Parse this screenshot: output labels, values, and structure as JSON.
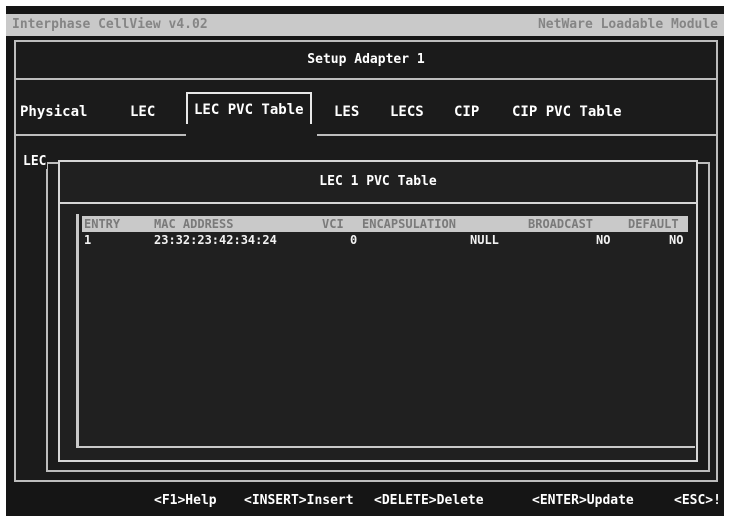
{
  "titlebar": {
    "app": "Interphase CellView  v4.02",
    "module": "NetWare Loadable Module"
  },
  "window": {
    "title": "Setup Adapter 1"
  },
  "tabs": [
    {
      "label": "Physical"
    },
    {
      "label": "LEC"
    },
    {
      "label": "LEC PVC Table",
      "active": true
    },
    {
      "label": "LES"
    },
    {
      "label": "LECS"
    },
    {
      "label": "CIP"
    },
    {
      "label": "CIP PVC Table"
    }
  ],
  "panel": {
    "group_label": "LEC",
    "table_title": "LEC 1 PVC Table",
    "columns": [
      "ENTRY",
      "MAC ADDRESS",
      "VCI",
      "ENCAPSULATION",
      "BROADCAST",
      "DEFAULT"
    ],
    "rows": [
      {
        "entry": "1",
        "mac": "23:32:23:42:34:24",
        "vci": "0",
        "encapsulation": "NULL",
        "broadcast": "NO",
        "default": "NO"
      }
    ]
  },
  "footer": {
    "keys": [
      "<F1>Help",
      "<INSERT>Insert",
      "<DELETE>Delete",
      "<ENTER>Update",
      "<ESC>!"
    ]
  },
  "colors": {
    "screen": "#151515",
    "titlebar": "#c9c9c9",
    "header_bar": "#c9c9c9",
    "text": "#ffffff"
  }
}
